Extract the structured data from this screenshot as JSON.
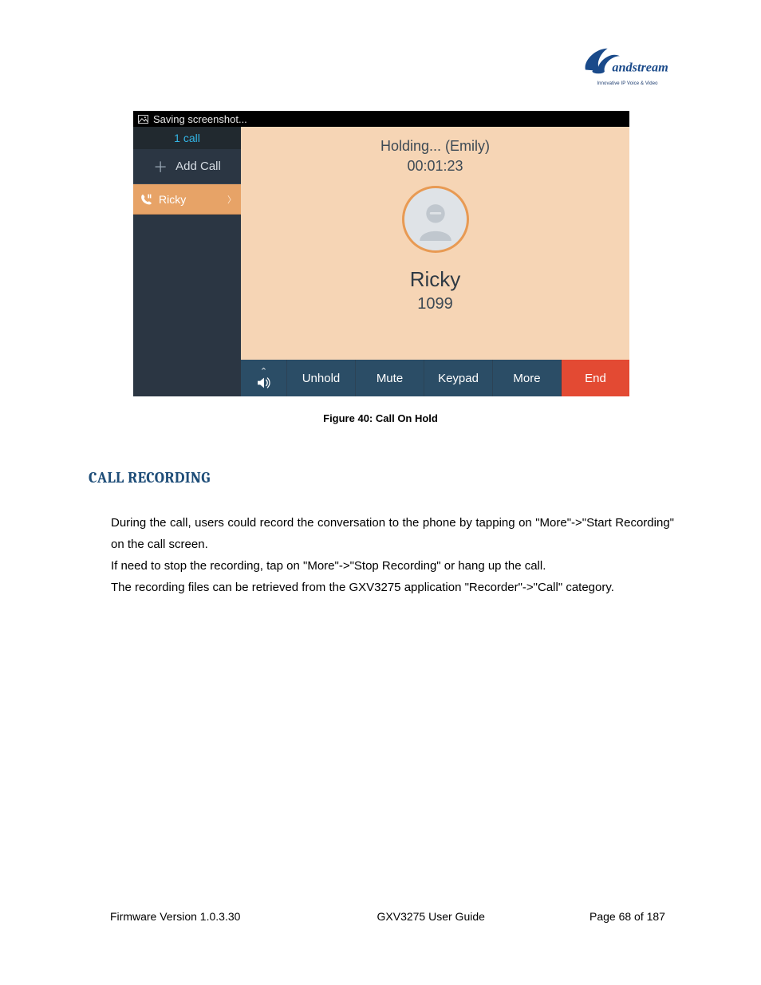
{
  "brand": {
    "name": "Grandstream",
    "tagline": "Innovative IP Voice & Video"
  },
  "phone": {
    "statusbar_text": "Saving screenshot...",
    "sidebar": {
      "call_count_label": "1 call",
      "add_call_label": "Add Call",
      "active_contact": "Ricky"
    },
    "call": {
      "status_text": "Holding... (Emily)",
      "timer": "00:01:23",
      "name": "Ricky",
      "number": "1099"
    },
    "buttons": {
      "unhold": "Unhold",
      "mute": "Mute",
      "keypad": "Keypad",
      "more": "More",
      "end": "End"
    }
  },
  "figure_caption": "Figure 40: Call On Hold",
  "section_heading": "CALL RECORDING",
  "paragraphs": {
    "p1": "During the call, users could record the conversation to the phone by tapping on \"More\"->\"Start Recording\" on the call screen.",
    "p2": "If need to stop the recording, tap on \"More\"->\"Stop Recording\" or hang up the call.",
    "p3": "The recording files can be retrieved from the GXV3275 application \"Recorder\"->\"Call\" category."
  },
  "footer": {
    "firmware": "Firmware Version 1.0.3.30",
    "doc_title": "GXV3275 User Guide",
    "page": "Page 68 of 187"
  }
}
